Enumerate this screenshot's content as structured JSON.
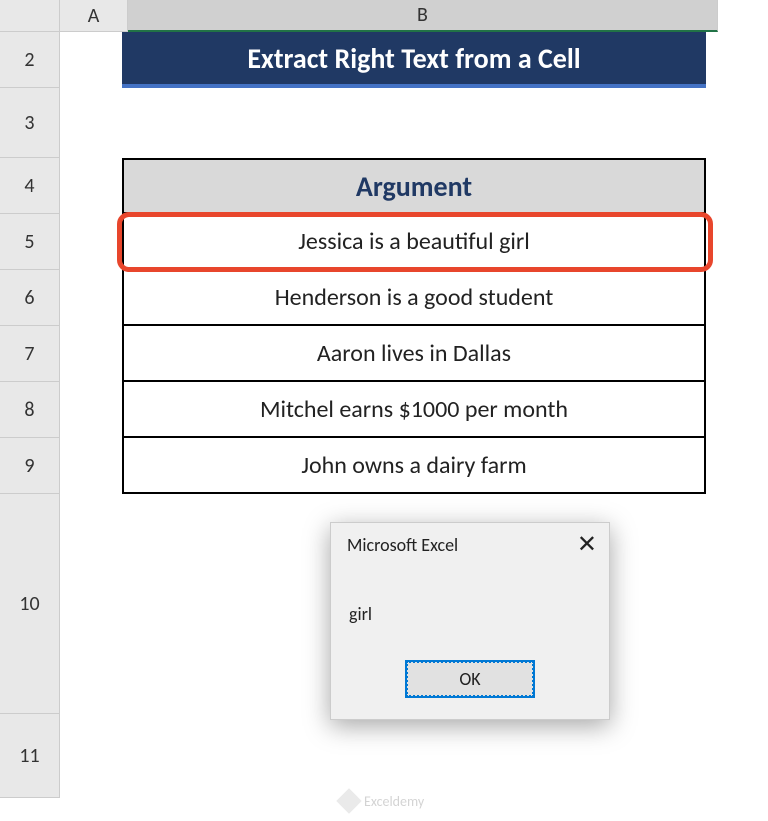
{
  "columns": {
    "A": "A",
    "B": "B"
  },
  "rows": {
    "r2": "2",
    "r3": "3",
    "r4": "4",
    "r5": "5",
    "r6": "6",
    "r7": "7",
    "r8": "8",
    "r9": "9",
    "r10": "10",
    "r11": "11"
  },
  "title": "Extract Right Text from a Cell",
  "table": {
    "header": "Argument",
    "rows": [
      "Jessica is a beautiful girl",
      "Henderson is a good student",
      "Aaron lives in Dallas",
      "Mitchel earns $1000 per month",
      "John owns a dairy farm"
    ]
  },
  "msgbox": {
    "title": "Microsoft Excel",
    "message": "girl",
    "ok": "OK"
  },
  "watermark": "Exceldemy"
}
